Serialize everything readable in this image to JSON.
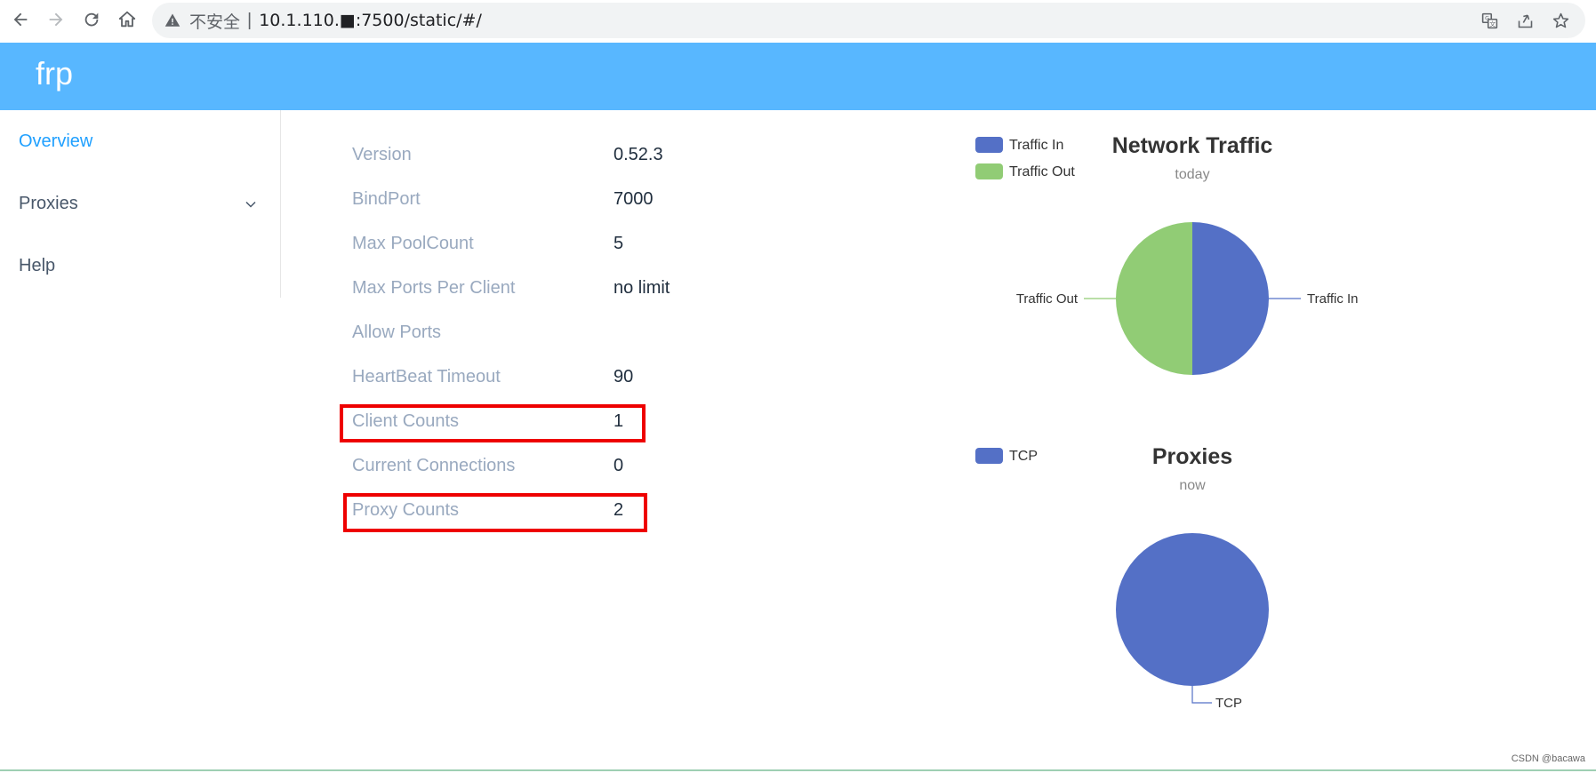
{
  "browser": {
    "security_label": "不安全",
    "url": "10.1.110.■:7500/static/#/"
  },
  "app": {
    "title": "frp"
  },
  "sidebar": {
    "items": [
      {
        "label": "Overview",
        "active": true
      },
      {
        "label": "Proxies",
        "has_submenu": true
      },
      {
        "label": "Help"
      }
    ]
  },
  "server_info": {
    "rows": [
      {
        "label": "Version",
        "value": "0.52.3"
      },
      {
        "label": "BindPort",
        "value": "7000"
      },
      {
        "label": "Max PoolCount",
        "value": "5"
      },
      {
        "label": "Max Ports Per Client",
        "value": "no limit"
      },
      {
        "label": "Allow Ports",
        "value": ""
      },
      {
        "label": "HeartBeat Timeout",
        "value": "90"
      },
      {
        "label": "Client Counts",
        "value": "1",
        "highlighted": true
      },
      {
        "label": "Current Connections",
        "value": "0"
      },
      {
        "label": "Proxy Counts",
        "value": "2",
        "highlighted": true
      }
    ]
  },
  "chart_data": [
    {
      "type": "pie",
      "title": "Network Traffic",
      "subtitle": "today",
      "legend_position": "top-left",
      "categories": [
        "Traffic In",
        "Traffic Out"
      ],
      "values": [
        50,
        50
      ],
      "colors": [
        "#5470c6",
        "#91cc75"
      ]
    },
    {
      "type": "pie",
      "title": "Proxies",
      "subtitle": "now",
      "legend_position": "top-left",
      "categories": [
        "TCP"
      ],
      "values": [
        100
      ],
      "colors": [
        "#5470c6"
      ]
    }
  ],
  "footer": {
    "watermark": "CSDN @bacawa"
  }
}
